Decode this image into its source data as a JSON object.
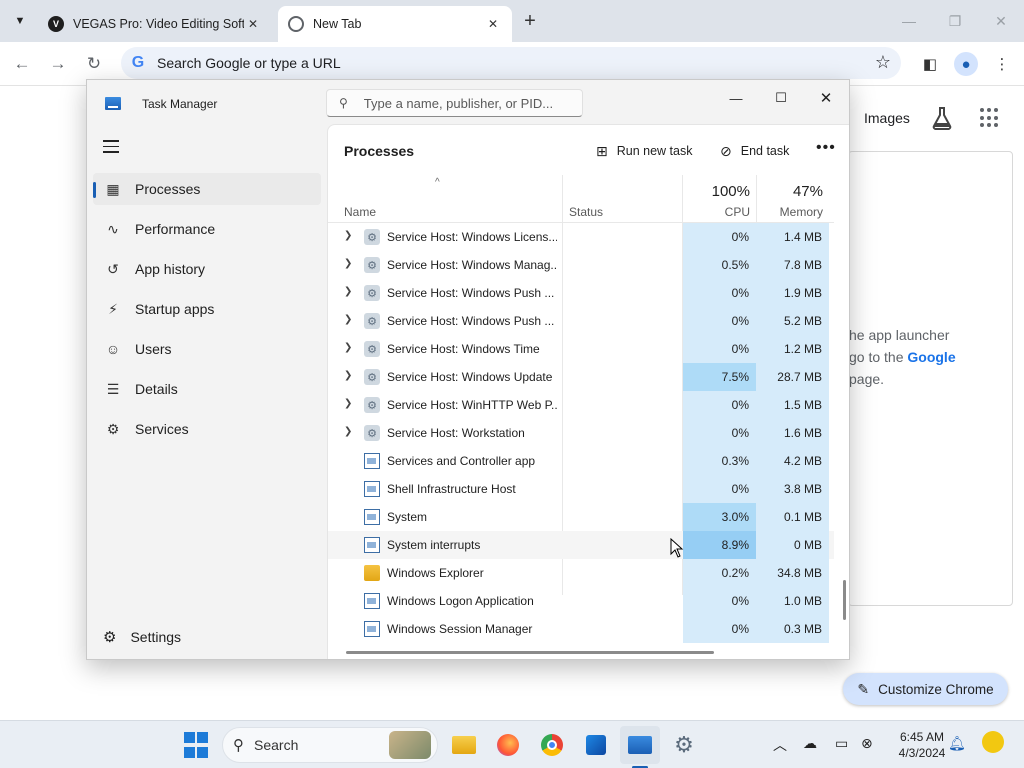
{
  "browser": {
    "tabs": [
      {
        "title": "VEGAS Pro: Video Editing Softw",
        "favicon_letter": "V",
        "active": false
      },
      {
        "title": "New Tab",
        "active": true
      }
    ],
    "omnibox_placeholder": "Search Google or type a URL",
    "ntp": {
      "images_link": "Images",
      "text_line1": "he app launcher",
      "text_line2_prefix": "go to the ",
      "text_line2_link": "Google",
      "text_line3": "page.",
      "customize_label": "Customize Chrome"
    }
  },
  "task_manager": {
    "title": "Task Manager",
    "search_placeholder": "Type a name, publisher, or PID...",
    "nav": [
      {
        "label": "Processes",
        "icon": "processes-icon",
        "selected": true
      },
      {
        "label": "Performance",
        "icon": "performance-icon"
      },
      {
        "label": "App history",
        "icon": "history-icon"
      },
      {
        "label": "Startup apps",
        "icon": "startup-icon"
      },
      {
        "label": "Users",
        "icon": "users-icon"
      },
      {
        "label": "Details",
        "icon": "details-icon"
      },
      {
        "label": "Services",
        "icon": "services-icon"
      }
    ],
    "settings_label": "Settings",
    "page_title": "Processes",
    "run_new_task_label": "Run new task",
    "end_task_label": "End task",
    "columns": {
      "name": "Name",
      "status": "Status",
      "cpu_label": "CPU",
      "cpu_total": "100%",
      "memory_label": "Memory",
      "memory_total": "47%"
    },
    "processes": [
      {
        "name": "Service Host: Windows Licens...",
        "icon": "gear",
        "expandable": true,
        "cpu": "0%",
        "memory": "1.4 MB"
      },
      {
        "name": "Service Host: Windows Manag...",
        "icon": "gear",
        "expandable": true,
        "cpu": "0.5%",
        "memory": "7.8 MB"
      },
      {
        "name": "Service Host: Windows Push ...",
        "icon": "gear",
        "expandable": true,
        "cpu": "0%",
        "memory": "1.9 MB"
      },
      {
        "name": "Service Host: Windows Push ...",
        "icon": "gear",
        "expandable": true,
        "cpu": "0%",
        "memory": "5.2 MB"
      },
      {
        "name": "Service Host: Windows Time",
        "icon": "gear",
        "expandable": true,
        "cpu": "0%",
        "memory": "1.2 MB"
      },
      {
        "name": "Service Host: Windows Update",
        "icon": "gear",
        "expandable": true,
        "cpu": "7.5%",
        "memory": "28.7 MB",
        "cpu_level": "med"
      },
      {
        "name": "Service Host: WinHTTP Web P...",
        "icon": "gear",
        "expandable": true,
        "cpu": "0%",
        "memory": "1.5 MB"
      },
      {
        "name": "Service Host: Workstation",
        "icon": "gear",
        "expandable": true,
        "cpu": "0%",
        "memory": "1.6 MB"
      },
      {
        "name": "Services and Controller app",
        "icon": "app",
        "expandable": false,
        "cpu": "0.3%",
        "memory": "4.2 MB"
      },
      {
        "name": "Shell Infrastructure Host",
        "icon": "app",
        "expandable": false,
        "cpu": "0%",
        "memory": "3.8 MB"
      },
      {
        "name": "System",
        "icon": "app",
        "expandable": false,
        "cpu": "3.0%",
        "memory": "0.1 MB",
        "cpu_level": "med"
      },
      {
        "name": "System interrupts",
        "icon": "app",
        "expandable": false,
        "cpu": "8.9%",
        "memory": "0 MB",
        "cpu_level": "high",
        "hovered": true
      },
      {
        "name": "Windows Explorer",
        "icon": "folder",
        "expandable": false,
        "cpu": "0.2%",
        "memory": "34.8 MB"
      },
      {
        "name": "Windows Logon Application",
        "icon": "app",
        "expandable": false,
        "cpu": "0%",
        "memory": "1.0 MB"
      },
      {
        "name": "Windows Session Manager",
        "icon": "app",
        "expandable": false,
        "cpu": "0%",
        "memory": "0.3 MB"
      }
    ]
  },
  "taskbar": {
    "search_label": "Search",
    "time": "6:45 AM",
    "date": "4/3/2024"
  }
}
